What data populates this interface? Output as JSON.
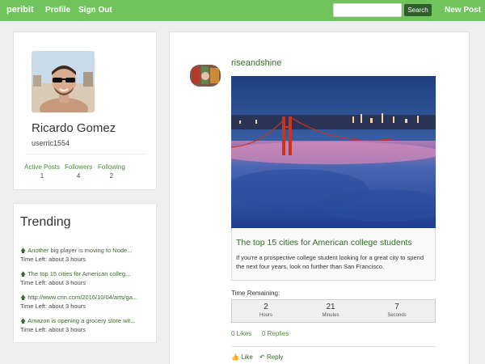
{
  "nav": {
    "brand": "peribit",
    "profile": "Profile",
    "signout": "Sign Out",
    "search_placeholder": "",
    "search_button": "Search",
    "new_post": "New Post"
  },
  "profile": {
    "name": "Ricardo Gomez",
    "username": "userric1554",
    "stats": [
      {
        "label": "Active Posts",
        "value": "1"
      },
      {
        "label": "Followers",
        "value": "4"
      },
      {
        "label": "Following",
        "value": "2"
      }
    ]
  },
  "trending": {
    "title": "Trending",
    "items": [
      {
        "text": "Another big player is moving to Node...",
        "time": "Time Left: about 3 hours"
      },
      {
        "text": "The top 15 cities for American colleg...",
        "time": "Time Left: about 3 hours"
      },
      {
        "text": "http://www.cnn.com/2016/10/04/arts/ga...",
        "time": "Time Left: about 3 hours"
      },
      {
        "text": "Amazon is opening a grocery store wit...",
        "time": "Time Left: about 3 hours"
      }
    ]
  },
  "post": {
    "user": "riseandshine",
    "title": "The top 15 cities for American college students",
    "description": "If you're a prospective college student looking for a great city to spend the next four years, look no further than San Francisco.",
    "time_label": "Time Remaining:",
    "timer": [
      {
        "value": "2",
        "unit": "Hours"
      },
      {
        "value": "21",
        "unit": "Minutes"
      },
      {
        "value": "7",
        "unit": "Seconds"
      }
    ],
    "likes": "0 Likes",
    "replies": "0 Replies",
    "like_action": "Like",
    "reply_action": "Reply"
  },
  "colors": {
    "nav_bg": "#71c45c",
    "accent": "#3b6b2c",
    "search_button": "#2e5e2a"
  },
  "icons": {
    "trend": "up-arrow-icon",
    "like": "thumbs-up-icon",
    "reply": "reply-arrow-icon"
  }
}
